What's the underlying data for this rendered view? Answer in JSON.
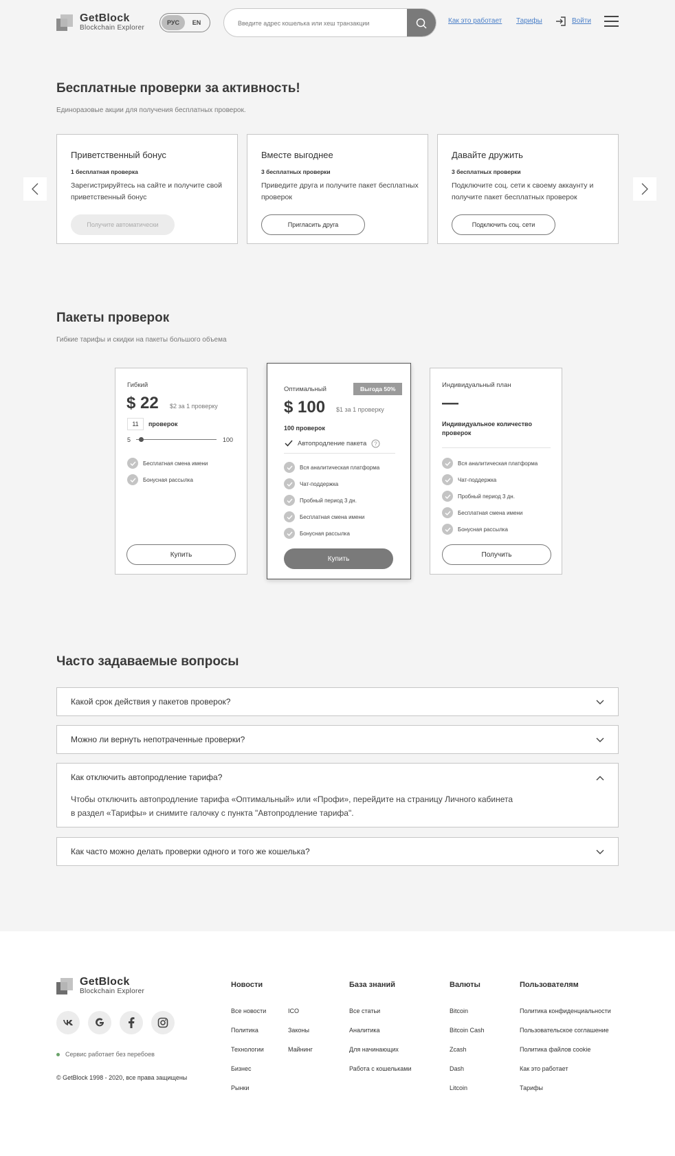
{
  "header": {
    "logo_name": "GetBlock",
    "logo_sub": "Blockchain Explorer",
    "lang_ru": "РУС",
    "lang_en": "EN",
    "search_placeholder": "Введите адрес кошелька или хеш транзакции",
    "nav_how": "Как это работает",
    "nav_tariffs": "Тарифы",
    "nav_login": "Войти"
  },
  "promo": {
    "title": "Бесплатные проверки за активность!",
    "subtitle": "Единоразовые акции для получения бесплатных проверок.",
    "cards": [
      {
        "title": "Приветственный бонус",
        "count": "1 бесплатная проверка",
        "desc": "Зарегистрируйтесь на сайте и получите свой приветственный бонус",
        "button": "Получите автоматически"
      },
      {
        "title": "Вместе выгоднее",
        "count": "3 бесплатных проверки",
        "desc": "Приведите друга и получите пакет бесплатных проверок",
        "button": "Пригласить друга"
      },
      {
        "title": "Давайте дружить",
        "count": "3 бесплатных проверки",
        "desc": "Подключите соц. сети к своему аккаунту и получите пакет бесплатных проверок",
        "button": "Подключить соц. сети"
      }
    ]
  },
  "pricing": {
    "title": "Пакеты проверок",
    "subtitle": "Гибкие тарифы и скидки на пакеты большого объема",
    "flexible": {
      "name": "Гибкий",
      "price": "$ 22",
      "per": "$2 за 1 проверку",
      "qty": "11",
      "qty_label": "проверок",
      "min": "5",
      "max": "100",
      "slider_fraction": 0.063,
      "features": [
        "Бесплатная смена имени",
        "Бонусная рассылка"
      ],
      "button": "Купить"
    },
    "optimal": {
      "name": "Оптимальный",
      "badge": "Выгода 50%",
      "price": "$ 100",
      "per": "$1 за 1 проверку",
      "count": "100 проверок",
      "auto_renew": "Автопродление пакета",
      "auto_renew_checked": true,
      "features": [
        "Вся аналитическая платформа",
        "Чат-поддержка",
        "Пробный период 3 дн.",
        "Бесплатная смена имени",
        "Бонусная рассылка"
      ],
      "button": "Купить"
    },
    "individual": {
      "name": "Индивидуальный план",
      "price": "—",
      "desc": "Индивидуальное количество проверок",
      "features": [
        "Вся аналитическая платформа",
        "Чат-поддержка",
        "Пробный период 3 дн.",
        "Бесплатная смена имени",
        "Бонусная рассылка"
      ],
      "button": "Получить"
    }
  },
  "faq": {
    "title": "Часто задаваемые вопросы",
    "items": [
      {
        "q": "Какой срок действия у пакетов проверок?"
      },
      {
        "q": "Можно ли вернуть непотраченные проверки?"
      },
      {
        "q": "Как отключить автопродление тарифа?",
        "a1": "Чтобы отключить автопродление тарифа «Оптимальный» или «Профи», перейдите на страницу Личного кабинета",
        "a2": "в раздел «Тарифы» и снимите галочку с пункта \"Автопродление тарифа\"."
      },
      {
        "q": "Как часто можно делать проверки одного и того же кошелька?"
      }
    ]
  },
  "footer": {
    "logo_name": "GetBlock",
    "logo_sub": "Blockchain Explorer",
    "social": [
      "vk-icon",
      "google-icon",
      "facebook-icon",
      "instagram-icon"
    ],
    "status": "Сервис работает без перебоев",
    "copyright": "© GetBlock 1998 - 2020, все права защищены",
    "news": {
      "title": "Новости",
      "col1": [
        "Все новости",
        "Политика",
        "Технологии",
        "Бизнес",
        "Рынки"
      ],
      "col2": [
        "ICO",
        "Законы",
        "Майнинг"
      ]
    },
    "knowledge": {
      "title": "База знаний",
      "links": [
        "Все статьи",
        "Аналитика",
        "Для начинающих",
        "Работа с кошельками"
      ]
    },
    "currencies": {
      "title": "Валюты",
      "links": [
        "Bitcoin",
        "Bitcoin Cash",
        "Zcash",
        "Dash",
        "Litcoin"
      ]
    },
    "users": {
      "title": "Пользователям",
      "links": [
        "Политика конфиденциальности",
        "Пользовательское соглашение",
        "Политика файлов cookie",
        "Как это  работает",
        "Тарифы"
      ]
    }
  }
}
